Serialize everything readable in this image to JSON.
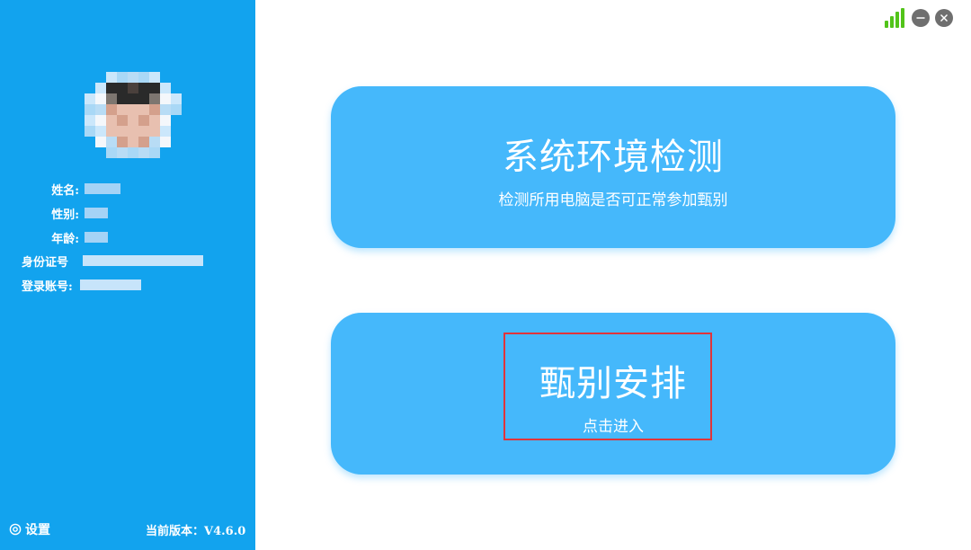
{
  "sidebar": {
    "labels": {
      "name": "姓名:",
      "gender": "性别:",
      "age": "年龄:",
      "id_number": "身份证号",
      "account": "登录账号:"
    },
    "settings_label": "设置",
    "version_label": "当前版本：V4.6.0",
    "icons": {
      "settings": "gear-icon",
      "avatar": "avatar-photo"
    },
    "background": "#12a3ee"
  },
  "cards": {
    "environment": {
      "title": "系统环境检测",
      "subtitle": "检测所用电脑是否可正常参加甄别"
    },
    "schedule": {
      "title": "甄别安排",
      "subtitle": "点击进入"
    },
    "color": "#45b8fb",
    "highlight_color": "#e0343a"
  },
  "window_controls": {
    "icons": [
      "signal-icon",
      "minimize-icon",
      "close-icon"
    ]
  }
}
